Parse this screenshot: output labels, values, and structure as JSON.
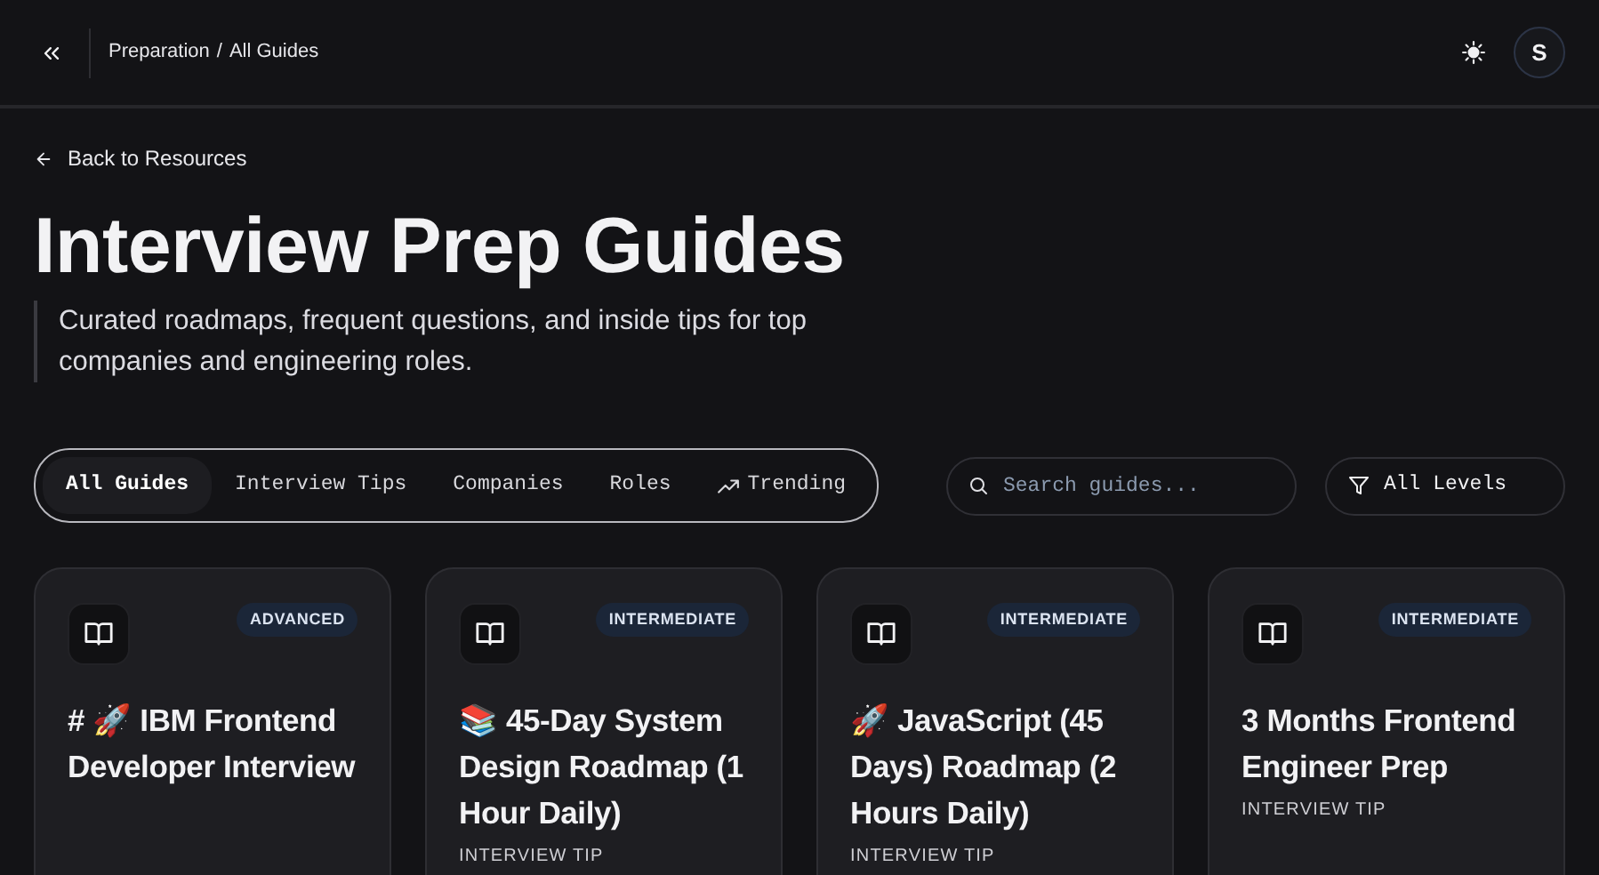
{
  "header": {
    "breadcrumb": [
      "Preparation",
      "All Guides"
    ],
    "breadcrumb_separator": "/",
    "avatar": "S"
  },
  "back_link": "Back to Resources",
  "title": "Interview Prep Guides",
  "description": "Curated roadmaps, frequent questions, and inside tips for top companies and engineering roles.",
  "tabs": [
    {
      "label": "All Guides",
      "selected": true
    },
    {
      "label": "Interview Tips",
      "selected": false
    },
    {
      "label": "Companies",
      "selected": false
    },
    {
      "label": "Roles",
      "selected": false
    },
    {
      "label": "Trending",
      "selected": false,
      "kind": "trending"
    }
  ],
  "search": {
    "placeholder": "Search guides..."
  },
  "level_filter": "All Levels",
  "guides": [
    {
      "level": "ADVANCED",
      "title": "# 🚀 IBM Frontend Developer Interview"
    },
    {
      "level": "INTERMEDIATE",
      "title": "📚 45-Day System Design Roadmap (1 Hour Daily)",
      "category": "INTERVIEW TIP"
    },
    {
      "level": "INTERMEDIATE",
      "title": "🚀 JavaScript (45 Days) Roadmap (2 Hours Daily)",
      "category": "INTERVIEW TIP"
    },
    {
      "level": "INTERMEDIATE",
      "title": "3 Months Frontend Engineer Prep",
      "category": "INTERVIEW TIP"
    }
  ]
}
